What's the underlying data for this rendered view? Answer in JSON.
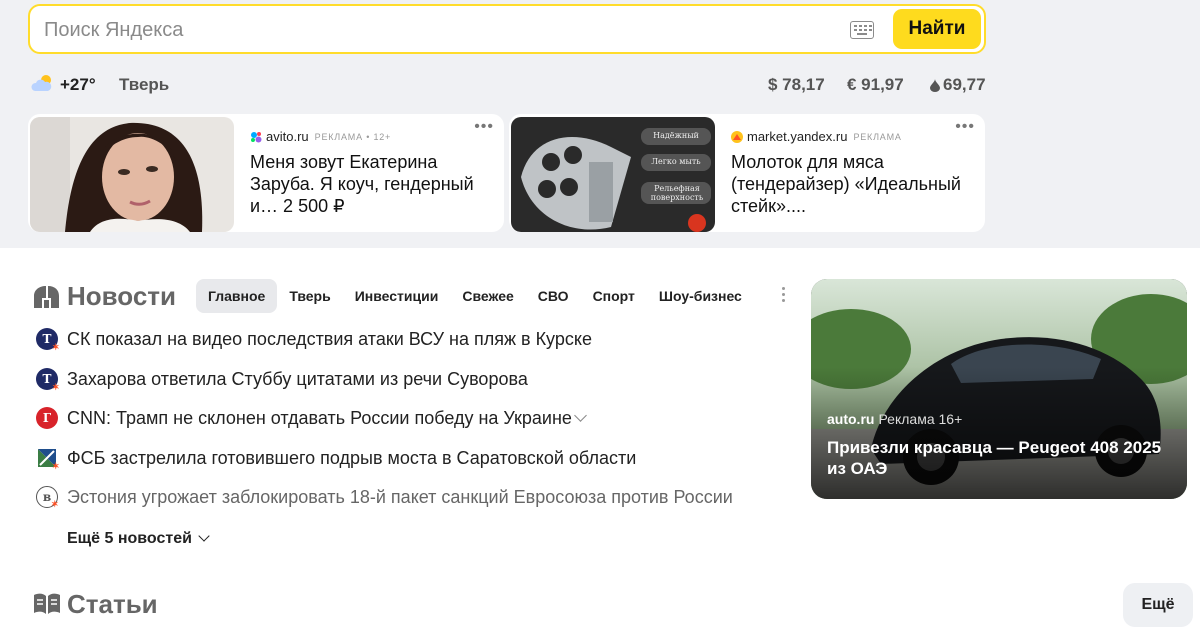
{
  "search": {
    "placeholder": "Поиск Яндекса",
    "button_label": "Найти",
    "accent_color": "#ffdc2b"
  },
  "info_bar": {
    "temperature": "+27°",
    "city": "Тверь",
    "weather_icon": "partly-cloudy-icon",
    "rates": [
      {
        "label": "$ 78,17"
      },
      {
        "label": "€ 91,97"
      },
      {
        "label": "69,77",
        "icon": "oil-drop-icon"
      }
    ]
  },
  "ads": [
    {
      "source": "avito.ru",
      "meta": "РЕКЛАМА • 12+",
      "title": "Меня зовут Екатерина Заруба. Я коуч, гендерный и… 2 500 ₽"
    },
    {
      "source": "market.yandex.ru",
      "meta": "РЕКЛАМА",
      "title": "Молоток для мяса (тендерайзер) «Идеальный стейк»....",
      "image_labels": [
        "Надёжный",
        "Легко мыть",
        "Рельефная поверхность"
      ]
    }
  ],
  "news": {
    "title": "Новости",
    "tabs": [
      "Главное",
      "Тверь",
      "Инвестиции",
      "Свежее",
      "СВО",
      "Спорт",
      "Шоу-бизнес"
    ],
    "active_tab": "Главное",
    "items": [
      {
        "text": "СК показал на видео последствия атаки ВСУ на пляж в Курске",
        "icon_letter": "Т"
      },
      {
        "text": "Захарова ответила Стуббу цитатами из речи Суворова",
        "icon_letter": "Т"
      },
      {
        "text": "CNN: Трамп не склонен отдавать России победу на Украине",
        "icon_letter": "Г"
      },
      {
        "text": "ФСБ застрелила готовившего подрыв моста в Саратовской области",
        "icon_letter": ""
      },
      {
        "text": "Эстония угрожает заблокировать 18-й пакет санкций Евросоюза против России",
        "icon_letter": "в"
      }
    ],
    "more_label": "Ещё 5 новостей"
  },
  "promo": {
    "source": "auto.ru",
    "meta": "Реклама 16+",
    "title": "Привезли красавца — Peugeot 408 2025 из ОАЭ"
  },
  "articles": {
    "title": "Статьи",
    "more_button": "Ещё"
  }
}
